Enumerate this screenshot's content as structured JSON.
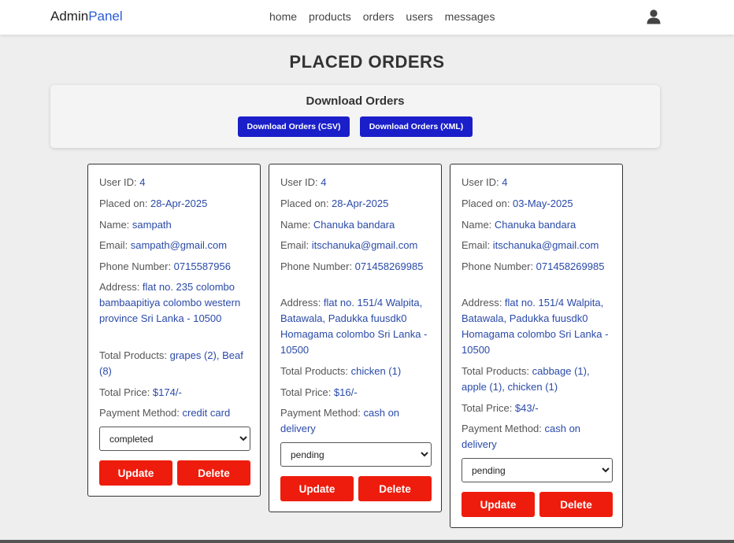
{
  "header": {
    "logo_main": "Admin",
    "logo_accent": "Panel",
    "nav": [
      "home",
      "products",
      "orders",
      "users",
      "messages"
    ]
  },
  "page": {
    "title": "PLACED ORDERS"
  },
  "download": {
    "title": "Download Orders",
    "csv_label": "Download Orders (CSV)",
    "xml_label": "Download Orders (XML)"
  },
  "labels": {
    "user_id": "User ID: ",
    "placed_on": "Placed on: ",
    "name": "Name: ",
    "email": "Email: ",
    "phone": "Phone Number: ",
    "address": "Address: ",
    "total_products": "Total Products: ",
    "total_price": "Total Price: ",
    "payment_method": "Payment Method: ",
    "update": "Update",
    "delete": "Delete"
  },
  "orders": [
    {
      "user_id": "4",
      "placed_on": "28-Apr-2025",
      "name": "sampath",
      "email": "sampath@gmail.com",
      "phone": "0715587956",
      "address": "flat no. 235 colombo bambaapitiya colombo western province Sri Lanka - 10500",
      "total_products": "grapes (2), Beaf (8)",
      "total_price": "$174/-",
      "payment_method": "credit card",
      "status": "completed"
    },
    {
      "user_id": "4",
      "placed_on": "28-Apr-2025",
      "name": "Chanuka bandara",
      "email": "itschanuka@gmail.com",
      "phone": "071458269985",
      "address": "flat no. 151/4 Walpita, Batawala, Padukka fuusdk0 Homagama colombo Sri Lanka - 10500",
      "total_products": "chicken (1)",
      "total_price": "$16/-",
      "payment_method": "cash on delivery",
      "status": "pending"
    },
    {
      "user_id": "4",
      "placed_on": "03-May-2025",
      "name": "Chanuka bandara",
      "email": "itschanuka@gmail.com",
      "phone": "071458269985",
      "address": "flat no. 151/4 Walpita, Batawala, Padukka fuusdk0 Homagama colombo Sri Lanka - 10500",
      "total_products": "cabbage (1), apple (1), chicken (1)",
      "total_price": "$43/-",
      "payment_method": "cash on delivery",
      "status": "pending"
    }
  ],
  "colors": {
    "accent": "#2a5bd7",
    "value_text": "#2a4aa8",
    "download_button": "#1a1fc9",
    "action_button": "#ee1c0c",
    "background": "#eeeeee"
  },
  "icons": {
    "user": "user-icon"
  }
}
